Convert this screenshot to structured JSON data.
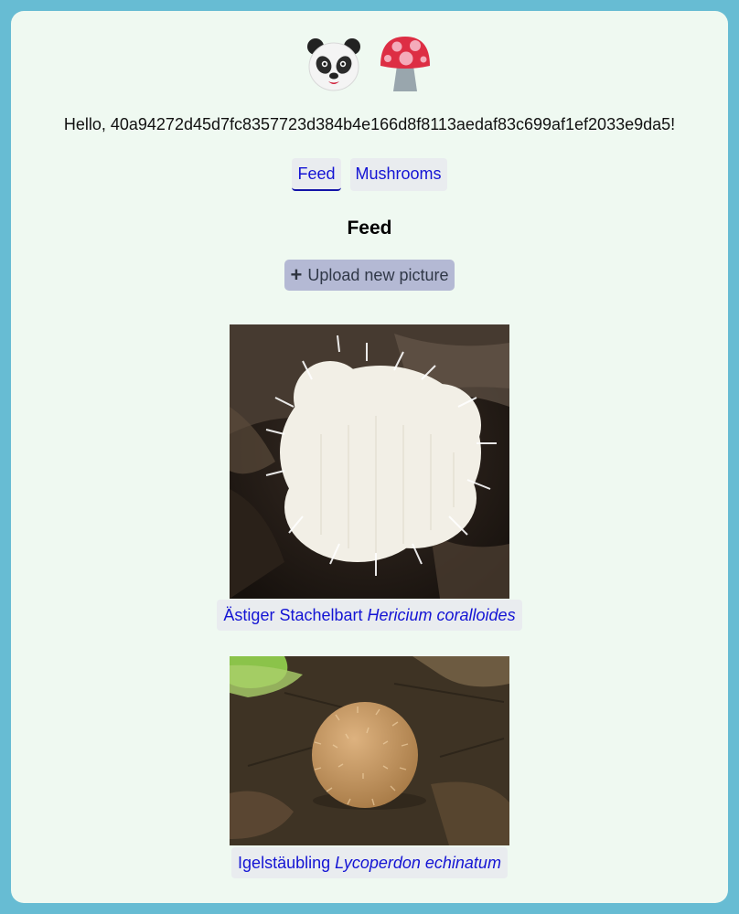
{
  "header": {
    "logos": [
      "panda-logo",
      "mushroom-logo"
    ],
    "greeting": "Hello, 40a94272d45d7fc8357723d384b4e166d8f8113aedaf83c699af1ef2033e9da5!"
  },
  "nav": {
    "tabs": [
      {
        "label": "Feed",
        "active": true
      },
      {
        "label": "Mushrooms",
        "active": false
      }
    ]
  },
  "main": {
    "title": "Feed",
    "upload_label": "Upload new picture",
    "upload_icon": "plus-icon",
    "posts": [
      {
        "common_name": "Ästiger Stachelbart",
        "latin_name": "Hericium coralloides"
      },
      {
        "common_name": "Igelstäubling",
        "latin_name": "Lycoperdon echinatum"
      }
    ]
  },
  "colors": {
    "border": "#67bcd3",
    "background": "#eff9f1",
    "link": "#1414d4",
    "button": "#b4b9d4"
  }
}
